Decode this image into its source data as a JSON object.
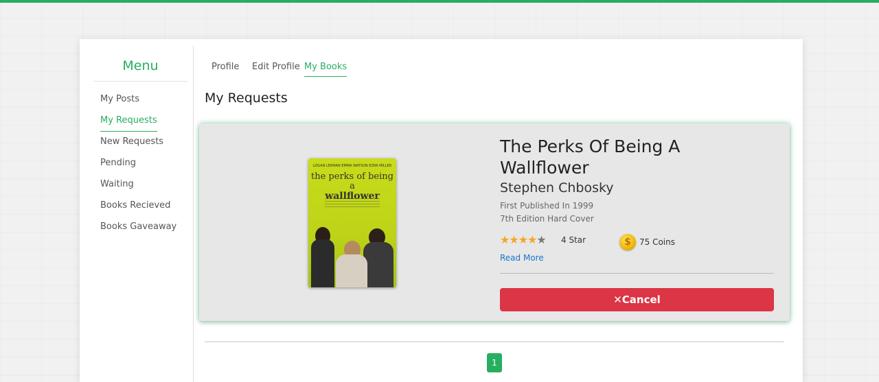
{
  "menu": {
    "title": "Menu",
    "items": [
      {
        "label": "My Posts"
      },
      {
        "label": "My Requests"
      },
      {
        "label": "New Requests"
      },
      {
        "label": "Pending"
      },
      {
        "label": "Waiting"
      },
      {
        "label": "Books Recieved"
      },
      {
        "label": "Books Gaveaway"
      }
    ],
    "active": "My Requests"
  },
  "tabs": [
    {
      "label": "Profile"
    },
    {
      "label": "Edit Profile"
    },
    {
      "label": "My Books"
    }
  ],
  "active_tab": "My Books",
  "section_title": "My Requests",
  "book": {
    "title": "The Perks Of Being A Wallflower",
    "author": "Stephen Chbosky",
    "first_published": "First Published In 1999",
    "edition": "7th Edition Hard Cover",
    "rating": 4,
    "rating_max": 5,
    "rating_text": "4 Star",
    "coins_text": "75 Coins",
    "read_more": "Read More",
    "cancel_label": "Cancel",
    "cover": {
      "names": "LOGAN LERMAN   EMMA WATSON   EZRA MILLER",
      "title_line1": "the perks of being a",
      "title_line2": "wallflower"
    }
  },
  "pagination": {
    "current": "1"
  },
  "colors": {
    "accent": "#27ae60",
    "danger": "#dc3545",
    "link": "#1a73c9",
    "star": "#f5a623"
  }
}
